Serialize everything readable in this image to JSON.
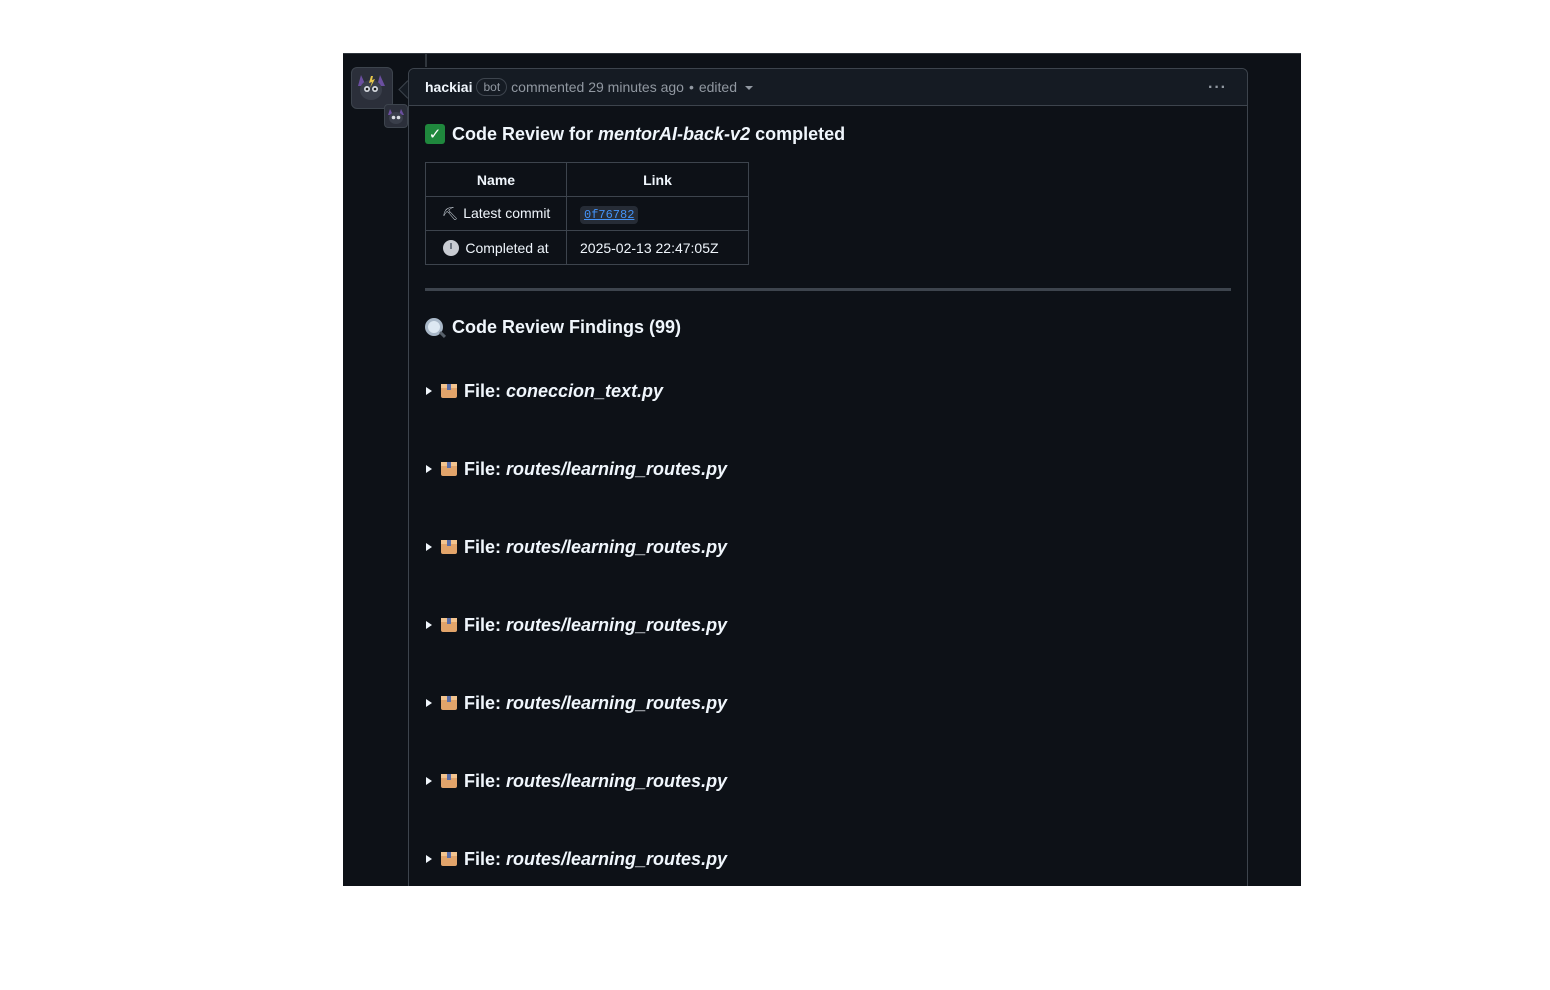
{
  "comment": {
    "author": "hackiai",
    "badge": "bot",
    "action": "commented 29 minutes ago",
    "separator": "•",
    "edited": "edited",
    "menu": "···"
  },
  "review": {
    "title_prefix": "Code Review for",
    "project": "mentorAI-back-v2",
    "title_suffix": "completed",
    "table": {
      "headers": [
        "Name",
        "Link"
      ],
      "rows": [
        {
          "name": "Latest commit",
          "value": "0f76782"
        },
        {
          "name": "Completed at",
          "value": "2025-02-13 22:47:05Z"
        }
      ]
    },
    "findings_heading": "Code Review Findings (99)",
    "file_label": "File:",
    "files": [
      "coneccion_text.py",
      "routes/learning_routes.py",
      "routes/learning_routes.py",
      "routes/learning_routes.py",
      "routes/learning_routes.py",
      "routes/learning_routes.py",
      "routes/learning_routes.py"
    ]
  }
}
